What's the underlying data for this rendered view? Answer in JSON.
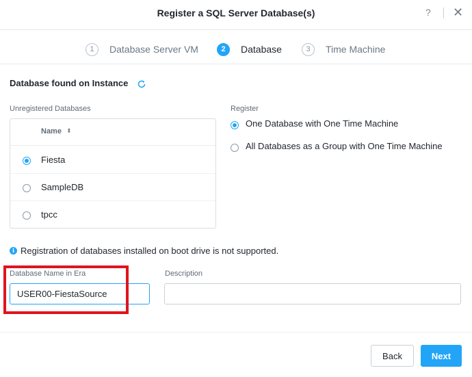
{
  "dialog": {
    "title": "Register a SQL Server Database(s)",
    "help_glyph": "?",
    "close_glyph": "✕"
  },
  "steps": [
    {
      "num": "1",
      "label": "Database Server VM"
    },
    {
      "num": "2",
      "label": "Database",
      "active": true
    },
    {
      "num": "3",
      "label": "Time Machine"
    }
  ],
  "section_title": "Database found on Instance",
  "unregistered": {
    "label": "Unregistered Databases",
    "column_header": "Name",
    "sort_glyph": "⬍",
    "rows": [
      {
        "name": "Fiesta",
        "selected": true
      },
      {
        "name": "SampleDB",
        "selected": false
      },
      {
        "name": "tpcc",
        "selected": false
      }
    ]
  },
  "register": {
    "label": "Register",
    "options": [
      {
        "label": "One Database with One Time Machine",
        "selected": true
      },
      {
        "label": "All Databases as a Group with One Time Machine",
        "selected": false
      }
    ]
  },
  "info": {
    "icon_glyph": "i",
    "text": "Registration of databases installed on boot drive is not supported."
  },
  "fields": {
    "db_name_label": "Database Name in Era",
    "db_name_value": "USER00-FiestaSource",
    "description_label": "Description",
    "description_value": ""
  },
  "buttons": {
    "back": "Back",
    "next": "Next"
  },
  "colors": {
    "accent": "#22a5f7",
    "highlight": "#e0141e"
  }
}
